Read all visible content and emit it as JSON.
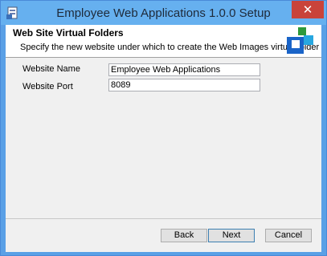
{
  "window": {
    "title": "Employee Web Applications 1.0.0 Setup",
    "close_glyph": "✕"
  },
  "banner": {
    "title": "Web Site Virtual Folders",
    "description": "Specify the new website under which to create the Web Images virtual folder",
    "logo_colors": [
      "#2f9a3c",
      "#27a7e0",
      "#1a64c8"
    ]
  },
  "form": {
    "website_name_label": "Website Name",
    "website_name_value": "Employee Web Applications",
    "website_port_label": "Website Port",
    "website_port_value": "8089"
  },
  "buttons": {
    "back": "Back",
    "next": "Next",
    "cancel": "Cancel"
  }
}
